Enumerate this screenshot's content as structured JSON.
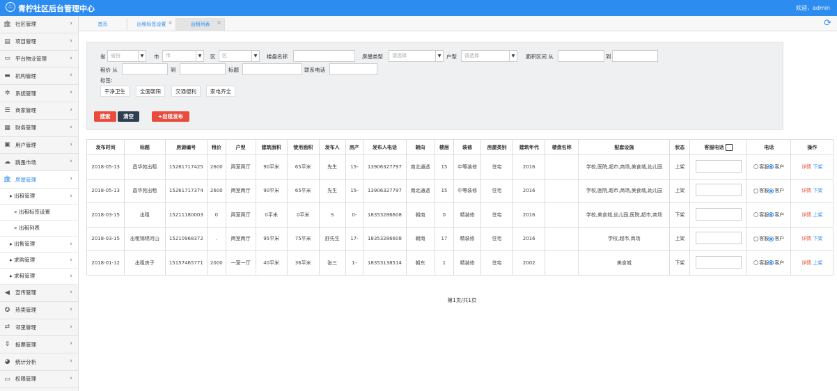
{
  "app": {
    "title": "青柠社区后台管理中心",
    "welcome": "欢迎，admin"
  },
  "sidebar": {
    "items": [
      {
        "label": "社区管理",
        "icon": "building-icon"
      },
      {
        "label": "项目管理",
        "icon": "project-icon"
      },
      {
        "label": "平台物业管理",
        "icon": "monitor-icon"
      },
      {
        "label": "机构管理",
        "icon": "institution-icon"
      },
      {
        "label": "系统管理",
        "icon": "settings-icon"
      },
      {
        "label": "商家管理",
        "icon": "list-icon"
      },
      {
        "label": "财务管理",
        "icon": "calculator-icon"
      },
      {
        "label": "用户管理",
        "icon": "user-icon"
      },
      {
        "label": "跳蚤市场",
        "icon": "cloud-icon"
      },
      {
        "label": "房屋管理",
        "icon": "house-icon"
      }
    ],
    "house_sub": [
      {
        "label": "出租管理"
      }
    ],
    "rent_sub": [
      {
        "label": "» 出租标签设置"
      },
      {
        "label": "» 出租列表"
      }
    ],
    "house_sub2": [
      {
        "label": "出售管理"
      },
      {
        "label": "求购管理"
      },
      {
        "label": "求租管理"
      }
    ],
    "items2": [
      {
        "label": "宣传管理",
        "icon": "megaphone-icon"
      },
      {
        "label": "热卖管理",
        "icon": "fire-icon"
      },
      {
        "label": "邻里管理",
        "icon": "neighbor-icon"
      },
      {
        "label": "投票管理",
        "icon": "vote-icon"
      },
      {
        "label": "统计分析",
        "icon": "pie-chart-icon"
      },
      {
        "label": "权限管理",
        "icon": "desktop-icon"
      }
    ]
  },
  "tabs": [
    {
      "label": "首页"
    },
    {
      "label": "出租标签设置"
    },
    {
      "label": "出租列表"
    }
  ],
  "filter": {
    "province_label": "省",
    "province_value": "省份",
    "city_label": "市",
    "city_value": "市",
    "district_label": "区",
    "district_value": "区",
    "estate_label": "楼盘名称",
    "house_type_label": "房屋类型",
    "house_type_value": "请选择",
    "layout_label": "户型",
    "layout_value": "请选择",
    "area_label": "面积区间 从",
    "area_to": "到",
    "rent_label": "租价 从",
    "rent_to": "到",
    "title_label": "标题",
    "phone_label": "联系电话",
    "tags_label": "标签:",
    "tags": [
      "干净卫生",
      "全面朝阳",
      "交通便利",
      "家电齐全"
    ],
    "search_btn": "搜索",
    "clear_btn": "清空",
    "publish_btn": "+出租发布"
  },
  "table": {
    "headers": [
      "发布时间",
      "标题",
      "房源编号",
      "租价",
      "户型",
      "建筑面积",
      "使用面积",
      "发布人",
      "房产",
      "发布人电话",
      "朝向",
      "楼层",
      "装修",
      "房屋类别",
      "建筑年代",
      "楼盘名称",
      "配套设施",
      "状态",
      "客服电话",
      "电话",
      "操作"
    ],
    "rows": [
      [
        "2018-05-13",
        "昌华苑出租",
        "15261717425",
        "2600",
        "两室两厅",
        "90平米",
        "65平米",
        "先生",
        "15-",
        "13906327797",
        "南北通透",
        "15",
        "中等装修",
        "住宅",
        "2016",
        "",
        "学校,医院,超市,商场,美食城,幼儿园",
        "上架"
      ],
      [
        "2018-05-13",
        "昌华苑出租",
        "15261717374",
        "2600",
        "两室两厅",
        "90平米",
        "65平米",
        "先生",
        "15-",
        "13906327797",
        "南北通透",
        "15",
        "中等装修",
        "住宅",
        "2016",
        "",
        "学校,医院,超市,商场,美食城,幼儿园",
        "上架"
      ],
      [
        "2018-03-15",
        "出租",
        "15211180003",
        "0",
        "两室两厅",
        "0平米",
        "0平米",
        "S",
        "0-",
        "18353286608",
        "朝南",
        "0",
        "精装修",
        "住宅",
        "2016",
        "",
        "学校,美食城,幼儿园,医院,超市,商场",
        "下架"
      ],
      [
        "2018-03-15",
        "出租锦绣河山",
        "15210968372",
        ".",
        "两室两厅",
        "95平米",
        "75平米",
        "舒先生",
        "17-",
        "18353286608",
        "朝南",
        "17",
        "精装修",
        "住宅",
        "2016",
        "",
        "学校,超市,商场",
        "上架"
      ],
      [
        "2018-01-12",
        "出租房子",
        "15157465771",
        "2000",
        "一室一厅",
        "40平米",
        "36平米",
        "张三",
        "1-",
        "18353138514",
        "朝东",
        "1",
        "精装修",
        "住宅",
        "2002",
        "",
        "美食城",
        "下架"
      ]
    ],
    "radio_labels": [
      "客服",
      "客户"
    ],
    "actions": [
      "详情",
      "下架",
      "上架"
    ],
    "row_actions": [
      [
        "详情",
        "下架"
      ],
      [
        "详情",
        "下架"
      ],
      [
        "详情",
        "上架"
      ],
      [
        "详情",
        "下架"
      ],
      [
        "详情",
        "上架"
      ]
    ]
  },
  "pager": {
    "text": "第1页/共1页"
  },
  "colors": {
    "primary": "#2d8cf0",
    "danger": "#e74c3c",
    "dark": "#2c3e50"
  }
}
